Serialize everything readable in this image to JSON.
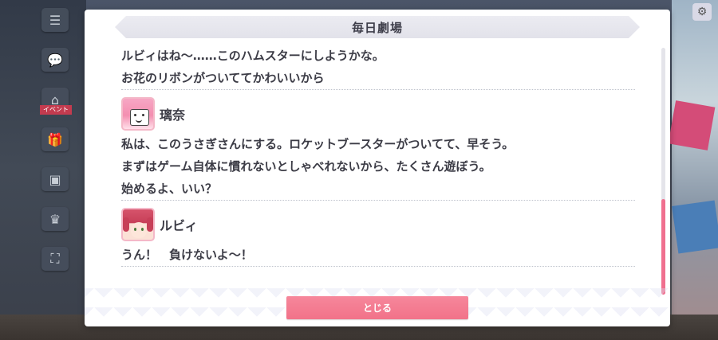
{
  "dialog": {
    "title": "毎日劇場",
    "close_label": "とじる"
  },
  "log": {
    "intro_lines": [
      "ルビィはね～……このハムスターにしようかな。",
      "お花のリボンがついててかわいいから"
    ],
    "entries": [
      {
        "speaker": "璃奈",
        "lines": [
          "私は、このうさぎさんにする。ロケットブースターがついてて、早そう。",
          "まずはゲーム自体に慣れないとしゃべれないから、たくさん遊ぼう。",
          "始めるよ、いい？"
        ]
      },
      {
        "speaker": "ルビィ",
        "lines": [
          "うん！　負けないよ～！"
        ]
      }
    ]
  },
  "left_menu": {
    "event_tag": "イベント",
    "icons": [
      "menu-icon",
      "chat-icon",
      "gift-icon",
      "camera-icon",
      "trophy-icon",
      "fullscreen-icon"
    ]
  },
  "colors": {
    "accent": "#f27289",
    "text": "#3c3c46",
    "title_bg": "#e6e6ee"
  },
  "scroll": {
    "position_fraction": 0.62
  }
}
